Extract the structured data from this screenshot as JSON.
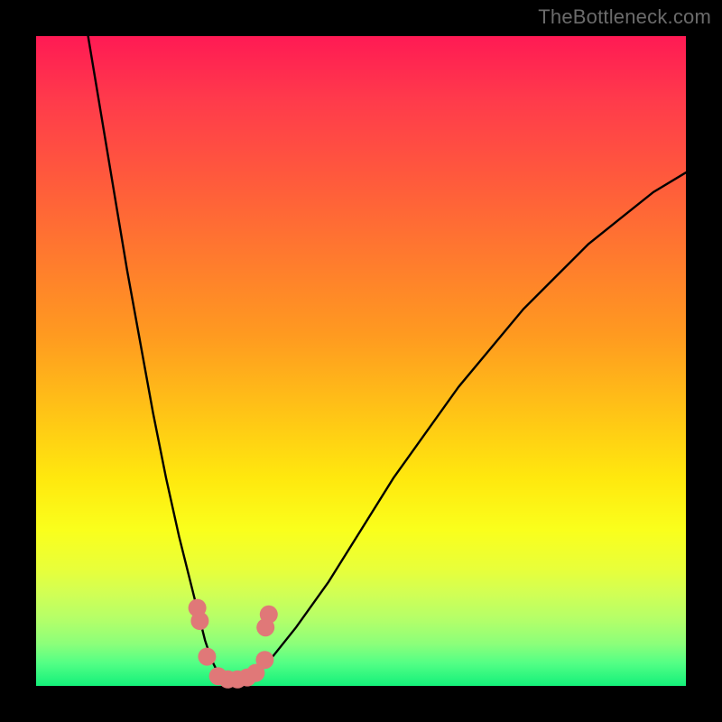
{
  "watermark": {
    "text": "TheBottleneck.com"
  },
  "chart_data": {
    "type": "line",
    "title": "",
    "xlabel": "",
    "ylabel": "",
    "xlim": [
      0,
      100
    ],
    "ylim": [
      0,
      100
    ],
    "grid": false,
    "legend": false,
    "annotations": [],
    "series": [
      {
        "name": "bottleneck-curve",
        "x": [
          8,
          10,
          12,
          14,
          16,
          18,
          20,
          22,
          24,
          25,
          26,
          27,
          28,
          29,
          30,
          32,
          34,
          36,
          40,
          45,
          50,
          55,
          60,
          65,
          70,
          75,
          80,
          85,
          90,
          95,
          100
        ],
        "values": [
          100,
          88,
          76,
          64,
          53,
          42,
          32,
          23,
          15,
          11,
          7,
          4,
          2,
          1,
          1,
          1,
          2,
          4,
          9,
          16,
          24,
          32,
          39,
          46,
          52,
          58,
          63,
          68,
          72,
          76,
          79
        ]
      }
    ],
    "markers": {
      "name": "highlighted-points",
      "color": "#e07878",
      "points": [
        {
          "x": 24.8,
          "y": 12
        },
        {
          "x": 25.2,
          "y": 10
        },
        {
          "x": 26.3,
          "y": 4.5
        },
        {
          "x": 28,
          "y": 1.5
        },
        {
          "x": 29.5,
          "y": 1
        },
        {
          "x": 31,
          "y": 1
        },
        {
          "x": 32.5,
          "y": 1.3
        },
        {
          "x": 33.8,
          "y": 2
        },
        {
          "x": 35.2,
          "y": 4
        },
        {
          "x": 35.3,
          "y": 9
        },
        {
          "x": 35.8,
          "y": 11
        }
      ]
    }
  }
}
